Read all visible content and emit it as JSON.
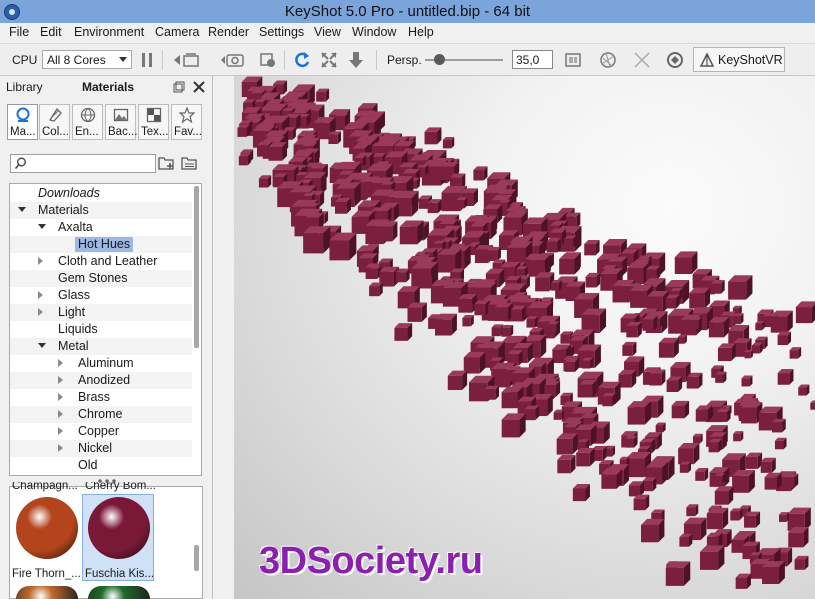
{
  "window": {
    "title": "KeyShot 5.0 Pro - untitled.bip  - 64 bit"
  },
  "menu": [
    "File",
    "Edit",
    "Environment",
    "Camera",
    "Render",
    "Settings",
    "View",
    "Window",
    "Help"
  ],
  "toolbar": {
    "cpu_label": "CPU",
    "cpu_value": "All 8 Cores",
    "persp_label": "Persp.",
    "persp_value": "35,0",
    "vr_label": "KeyShotVR"
  },
  "panel": {
    "library_label": "Library",
    "materials_label": "Materials",
    "tabs": [
      {
        "label": "Ma...",
        "icon": "materials-icon"
      },
      {
        "label": "Col...",
        "icon": "colors-icon"
      },
      {
        "label": "En...",
        "icon": "environments-icon"
      },
      {
        "label": "Bac...",
        "icon": "backplates-icon"
      },
      {
        "label": "Tex...",
        "icon": "textures-icon"
      },
      {
        "label": "Fav...",
        "icon": "favorites-icon"
      }
    ],
    "search_placeholder": "",
    "tree": [
      {
        "label": "Downloads",
        "indent": 0,
        "expander": "none",
        "italic": true
      },
      {
        "label": "Materials",
        "indent": 0,
        "expander": "open"
      },
      {
        "label": "Axalta",
        "indent": 1,
        "expander": "open"
      },
      {
        "label": "Hot Hues",
        "indent": 2,
        "expander": "none",
        "selected": true
      },
      {
        "label": "Cloth and Leather",
        "indent": 1,
        "expander": "closed"
      },
      {
        "label": "Gem Stones",
        "indent": 1,
        "expander": "none"
      },
      {
        "label": "Glass",
        "indent": 1,
        "expander": "closed"
      },
      {
        "label": "Light",
        "indent": 1,
        "expander": "closed"
      },
      {
        "label": "Liquids",
        "indent": 1,
        "expander": "none"
      },
      {
        "label": "Metal",
        "indent": 1,
        "expander": "open"
      },
      {
        "label": "Aluminum",
        "indent": 2,
        "expander": "closed"
      },
      {
        "label": "Anodized",
        "indent": 2,
        "expander": "closed"
      },
      {
        "label": "Brass",
        "indent": 2,
        "expander": "closed"
      },
      {
        "label": "Chrome",
        "indent": 2,
        "expander": "closed"
      },
      {
        "label": "Copper",
        "indent": 2,
        "expander": "closed"
      },
      {
        "label": "Nickel",
        "indent": 2,
        "expander": "closed"
      },
      {
        "label": "Old",
        "indent": 2,
        "expander": "none"
      }
    ],
    "thumbnails": [
      {
        "caption": "Champagn...",
        "color": "#c9a06a"
      },
      {
        "caption": "Cherry Bom...",
        "color": "#8a1a2a"
      },
      {
        "caption": "Fire Thorn_...",
        "color": "#b3441c"
      },
      {
        "caption": "Fuschia Kis...",
        "color": "#7a1838",
        "selected": true
      },
      {
        "caption": "",
        "color": "#c06a2a"
      },
      {
        "caption": "",
        "color": "#1f6a2a"
      }
    ]
  },
  "viewport": {
    "watermark": "3DSociety.ru",
    "cube_color": "#7a1f3d"
  },
  "colors": {
    "titlebar": "#7ba4da",
    "selection": "#9db8e4",
    "accent_refresh": "#1e73d6"
  }
}
